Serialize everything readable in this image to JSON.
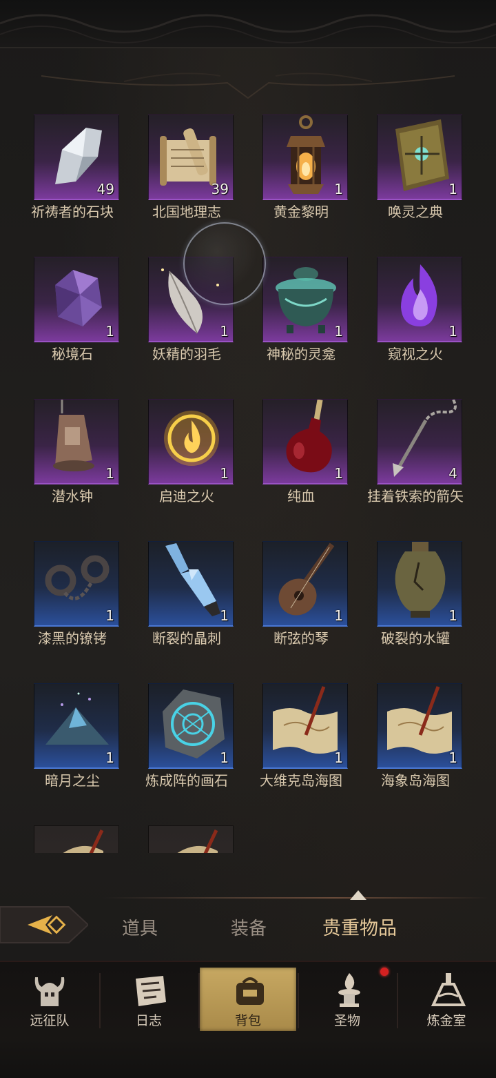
{
  "items": [
    {
      "name": "祈祷者的石块",
      "count": "49",
      "rarity": "purple",
      "icon": "stone-icon"
    },
    {
      "name": "北国地理志",
      "count": "39",
      "rarity": "purple",
      "icon": "scroll-icon"
    },
    {
      "name": "黄金黎明",
      "count": "1",
      "rarity": "purple",
      "icon": "lantern-icon"
    },
    {
      "name": "唤灵之典",
      "count": "1",
      "rarity": "purple",
      "icon": "book-icon"
    },
    {
      "name": "秘境石",
      "count": "1",
      "rarity": "purple",
      "icon": "crystal-icon"
    },
    {
      "name": "妖精的羽毛",
      "count": "1",
      "rarity": "purple",
      "icon": "feather-icon"
    },
    {
      "name": "神秘的灵龛",
      "count": "1",
      "rarity": "purple",
      "icon": "shrine-icon"
    },
    {
      "name": "窥视之火",
      "count": "1",
      "rarity": "purple",
      "icon": "purple-flame-icon"
    },
    {
      "name": "潜水钟",
      "count": "1",
      "rarity": "purple",
      "icon": "diving-bell-icon"
    },
    {
      "name": "启迪之火",
      "count": "1",
      "rarity": "purple",
      "icon": "fire-orb-icon"
    },
    {
      "name": "纯血",
      "count": "1",
      "rarity": "purple",
      "icon": "blood-flask-icon"
    },
    {
      "name": "挂着铁索的箭矢",
      "count": "4",
      "rarity": "purple",
      "icon": "chained-arrow-icon"
    },
    {
      "name": "漆黑的镣铐",
      "count": "1",
      "rarity": "blue",
      "icon": "shackles-icon"
    },
    {
      "name": "断裂的晶刺",
      "count": "1",
      "rarity": "blue",
      "icon": "crystal-spike-icon"
    },
    {
      "name": "断弦的琴",
      "count": "1",
      "rarity": "blue",
      "icon": "lute-icon"
    },
    {
      "name": "破裂的水罐",
      "count": "1",
      "rarity": "blue",
      "icon": "jar-icon"
    },
    {
      "name": "暗月之尘",
      "count": "1",
      "rarity": "blue",
      "icon": "dust-pile-icon"
    },
    {
      "name": "炼成阵的画石",
      "count": "1",
      "rarity": "blue",
      "icon": "rune-stone-icon"
    },
    {
      "name": "大维克岛海图",
      "count": "1",
      "rarity": "blue",
      "icon": "sea-chart-icon"
    },
    {
      "name": "海象岛海图",
      "count": "1",
      "rarity": "blue",
      "icon": "sea-chart-icon"
    }
  ],
  "tabs": {
    "items_label": "道具",
    "equipment_label": "装备",
    "valuables_label": "贵重物品",
    "active": "贵重物品"
  },
  "nav": {
    "expedition": "远征队",
    "journal": "日志",
    "backpack": "背包",
    "relics": "圣物",
    "alchemy": "炼金室",
    "active": "背包"
  },
  "colors": {
    "purple_rarity": "#9a53c4",
    "blue_rarity": "#4a78d4",
    "label_text": "#d9c9ae",
    "active_tab": "#e6c99a",
    "nav_active_bg": "#c7a862",
    "notification_dot": "#d42121"
  }
}
